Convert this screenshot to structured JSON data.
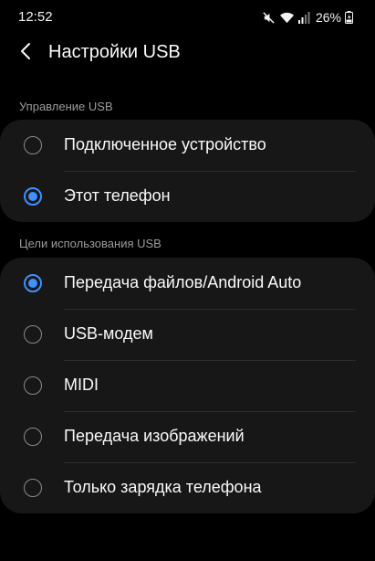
{
  "status_bar": {
    "time": "12:52",
    "battery": "26%",
    "icons": [
      "mute-icon",
      "wifi-icon",
      "signal-icon",
      "battery-icon"
    ]
  },
  "header": {
    "title": "Настройки USB",
    "back_icon": "chevron-left-icon"
  },
  "usb_control": {
    "header": "Управление USB",
    "options": [
      {
        "label": "Подключенное устройство",
        "selected": false
      },
      {
        "label": "Этот телефон",
        "selected": true
      }
    ]
  },
  "usb_purpose": {
    "header": "Цели использования USB",
    "options": [
      {
        "label": "Передача файлов/Android Auto",
        "selected": true
      },
      {
        "label": "USB-модем",
        "selected": false
      },
      {
        "label": "MIDI",
        "selected": false
      },
      {
        "label": "Передача изображений",
        "selected": false
      },
      {
        "label": "Только зарядка телефона",
        "selected": false
      }
    ]
  },
  "colors": {
    "background": "#000000",
    "card": "#171717",
    "accent": "#3e91ff",
    "secondary_text": "#9b9b9b"
  }
}
